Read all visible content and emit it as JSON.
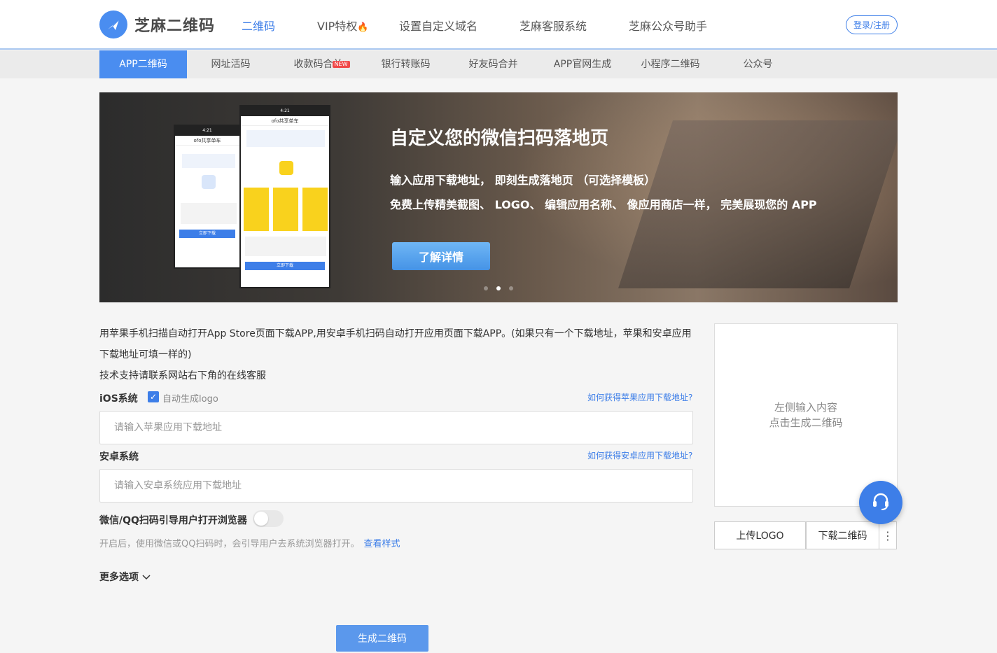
{
  "header": {
    "logo_text": "芝麻二维码",
    "nav": [
      {
        "label": "二维码",
        "active": true
      },
      {
        "label": "VIP特权",
        "badge_icon": "fire-icon"
      },
      {
        "label": "设置自定义域名"
      },
      {
        "label": "芝麻客服系统"
      },
      {
        "label": "芝麻公众号助手"
      }
    ],
    "login_label": "登录/注册"
  },
  "subnav": {
    "items": [
      {
        "label": "APP二维码",
        "active": true
      },
      {
        "label": "网址活码"
      },
      {
        "label": "收款码合并",
        "badge": "NEW"
      },
      {
        "label": "银行转账码"
      },
      {
        "label": "好友码合并"
      },
      {
        "label": "APP官网生成"
      },
      {
        "label": "小程序二维码"
      },
      {
        "label": "公众号"
      }
    ]
  },
  "banner": {
    "title": "自定义您的微信扫码落地页",
    "line1": "输入应用下载地址， 即刻生成落地页 （可选择模板）",
    "line2": "免费上传精美截图、 LOGO、 编辑应用名称、 像应用商店一样， 完美展现您的 APP",
    "button": "了解详情",
    "phone_left_title": "ofo共享单车",
    "phone_right_title": "ofo共享单车",
    "phone_btn": "立即下载",
    "slides": 3,
    "active_slide": 2
  },
  "form": {
    "desc_line1": "用苹果手机扫描自动打开App Store页面下载APP,用安卓手机扫码自动打开应用页面下载APP。(如果只有一个下载地址，苹果和安卓应用",
    "desc_line2": "下载地址可填一样的)",
    "desc_line3": "技术支持请联系网站右下角的在线客服",
    "ios_label": "iOS系统",
    "auto_logo_label": "自动生成logo",
    "auto_logo_checked": true,
    "ios_help": "如何获得苹果应用下载地址?",
    "ios_placeholder": "请输入苹果应用下载地址",
    "android_label": "安卓系统",
    "android_help": "如何获得安卓应用下载地址?",
    "android_placeholder": "请输入安卓系统应用下载地址",
    "wechat_label": "微信/QQ扫码引导用户打开浏览器",
    "wechat_toggle_on": false,
    "wechat_hint": "开启后，使用微信或QQ扫码时，会引导用户去系统浏览器打开。",
    "wechat_hint_link": "查看样式",
    "more_options": "更多选项",
    "generate_button": "生成二维码"
  },
  "qr_panel": {
    "placeholder_line1": "左侧输入内容",
    "placeholder_line2": "点击生成二维码",
    "upload_logo": "上传LOGO",
    "download_qr": "下载二维码"
  }
}
